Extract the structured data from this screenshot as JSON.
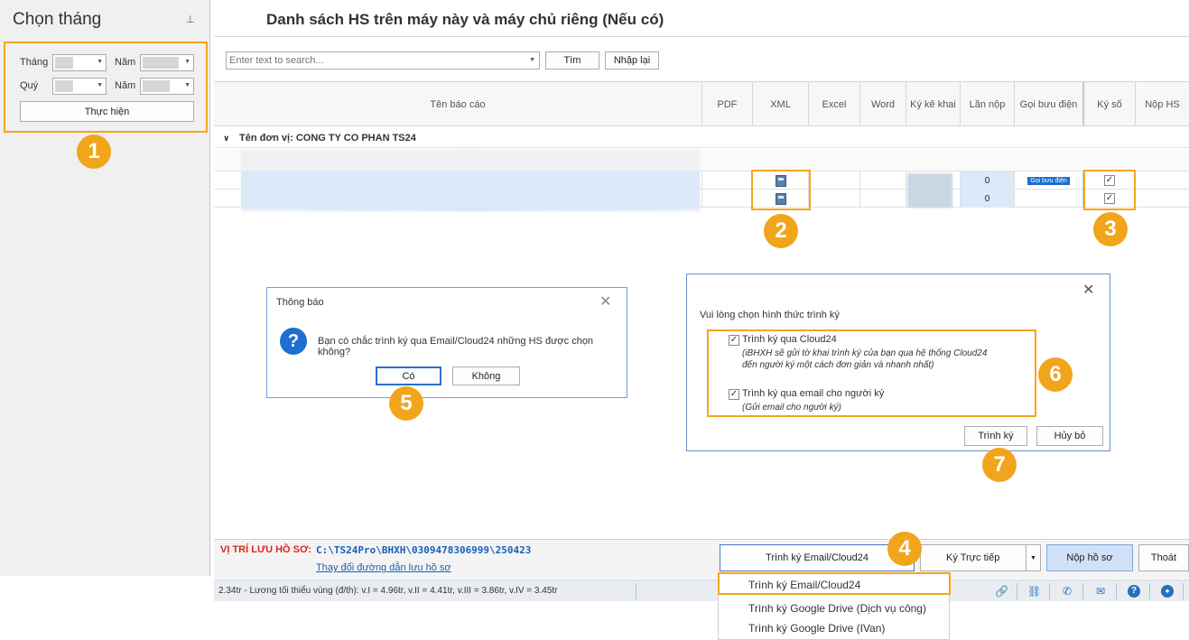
{
  "left_panel": {
    "title": "Chọn tháng",
    "pin_icon": "pin-icon",
    "thang_label": "Tháng",
    "nam_label": "Năm",
    "quy_label": "Quý",
    "thuc_hien": "Thực hiện"
  },
  "main": {
    "title": "Danh sách HS trên máy này và máy chủ riêng (Nếu có)",
    "search_placeholder": "Enter text to search...",
    "tim": "Tìm",
    "nhap_lai": "Nhập lại"
  },
  "grid": {
    "columns": [
      "Tên báo cáo",
      "PDF",
      "XML",
      "Excel",
      "Word",
      "Ký kê khai",
      "Lần nộp",
      "Gọi bưu điện",
      "Ký số",
      "Nộp HS"
    ],
    "group_label": "Tên đơn vị: CONG TY CO PHAN TS24",
    "rows": [
      {
        "lan_nop": "0",
        "goi_buu_dien": "Gọi bưu điện",
        "ky_so": "✓"
      },
      {
        "lan_nop": "0",
        "goi_buu_dien": "",
        "ky_so": "✓"
      }
    ]
  },
  "dialog_confirm": {
    "title": "Thông báo",
    "message": "Bạn có chắc trình ký qua Email/Cloud24  những HS được chọn không?",
    "yes": "Có",
    "no": "Không"
  },
  "dialog_sign": {
    "prompt": "Vui lòng chọn hình thức trình ký",
    "option1": "Trình ký qua Cloud24",
    "option1_note_1": "(iBHXH sẽ gửi tờ khai trình ký của bạn qua hệ thống Cloud24",
    "option1_note_2": "đến người ký một cách đơn giản và nhanh nhất)",
    "option2": "Trình ký qua email cho người ký",
    "option2_note": "(Gửi email cho người ký)",
    "submit": "Trình ký",
    "cancel": "Hủy bỏ"
  },
  "bottom": {
    "path_label": "VỊ TRÍ LƯU HỒ SƠ:",
    "path_value": "C:\\TS24Pro\\BHXH\\0309478306999\\250423",
    "change_path": "Thay đổi đường dẫn lưu hồ sơ",
    "btn_email": "Trình ký Email/Cloud24",
    "btn_direct": "Ký Trực tiếp",
    "btn_submit": "Nộp hồ sơ",
    "btn_exit": "Thoát"
  },
  "dropdown": {
    "items": [
      "Trình ký Email/Cloud24",
      "Trình ký Google Drive (Dịch vụ công)",
      "Trình ký Google Drive (IVan)"
    ]
  },
  "status": {
    "text": "2.34tr - Lương tối thiểu vùng (đ/th): v.I =  4.96tr, v.II = 4.41tr, v.III = 3.86tr, v.IV = 3.45tr"
  },
  "badges": [
    "1",
    "2",
    "3",
    "4",
    "5",
    "6",
    "7"
  ],
  "colors": {
    "accent": "#f0a51b",
    "path_red": "#d9261c",
    "path_blue": "#1a5fb4",
    "selected_row": "#dbe9f9"
  }
}
